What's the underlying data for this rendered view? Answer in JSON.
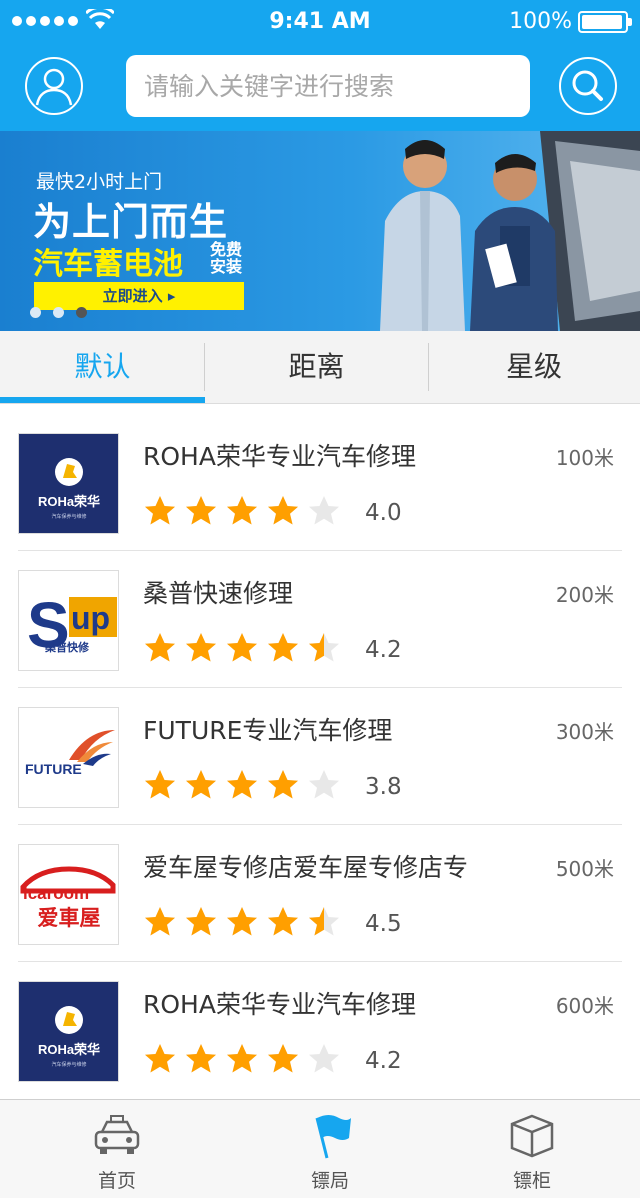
{
  "status_bar": {
    "time": "9:41 AM",
    "battery": "100%",
    "battery_level": 1.0
  },
  "search": {
    "placeholder": "请输入关键字进行搜索"
  },
  "banner": {
    "line1": "最快2小时上门",
    "line2": "为上门而生",
    "line3": "汽车蓄电池",
    "line4": "免费安装",
    "cta": "立即进入 ▸",
    "page_count": 3,
    "active_page": 3
  },
  "tabs": [
    {
      "label": "默认",
      "active": true
    },
    {
      "label": "距离",
      "active": false
    },
    {
      "label": "星级",
      "active": false
    }
  ],
  "shops": [
    {
      "name": "ROHA荣华专业汽车修理",
      "distance": "100米",
      "rating": 4.0,
      "rating_text": "4.0",
      "logo": "roha"
    },
    {
      "name": "桑普快速修理",
      "distance": "200米",
      "rating": 4.5,
      "rating_text": "4.2",
      "logo": "sup"
    },
    {
      "name": "FUTURE专业汽车修理",
      "distance": "300米",
      "rating": 4.0,
      "rating_text": "3.8",
      "logo": "future"
    },
    {
      "name": "爱车屋专修店爱车屋专修店专",
      "distance": "500米",
      "rating": 4.5,
      "rating_text": "4.5",
      "logo": "icaroom"
    },
    {
      "name": "ROHA荣华专业汽车修理",
      "distance": "600米",
      "rating": 4.0,
      "rating_text": "4.2",
      "logo": "roha"
    }
  ],
  "logos": {
    "roha": {
      "brand": "ROHa荣华",
      "sub": "汽车保养与维修"
    },
    "sup": {
      "brand_a": "S",
      "brand_b": "up",
      "sub": "桑普快修"
    },
    "future": {
      "brand": "FUTURE"
    },
    "icaroom": {
      "brand": "icaroom",
      "sub": "爱車屋"
    }
  },
  "tabbar": [
    {
      "label": "首页",
      "icon": "car-icon"
    },
    {
      "label": "镖局",
      "icon": "flag-icon"
    },
    {
      "label": "镖柜",
      "icon": "box-icon"
    }
  ],
  "colors": {
    "primary": "#16a6ef",
    "star": "#ff9f00",
    "star_empty": "#e8e8e8",
    "banner_yellow": "#fff100"
  }
}
